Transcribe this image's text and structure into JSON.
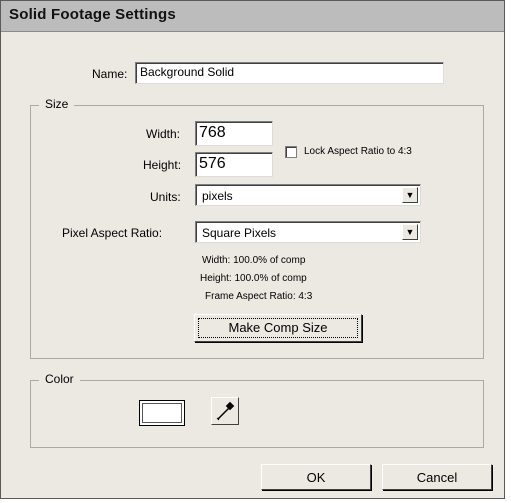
{
  "window": {
    "title": "Solid Footage Settings"
  },
  "name_field": {
    "label": "Name:",
    "value": "Background Solid"
  },
  "size_group": {
    "legend": "Size",
    "width_label": "Width:",
    "width_value": "768",
    "height_label": "Height:",
    "height_value": "576",
    "lock_label": "Lock Aspect Ratio to 4:3",
    "lock_checked": false,
    "units_label": "Units:",
    "units_value": "pixels",
    "par_label": "Pixel Aspect Ratio:",
    "par_value": "Square Pixels",
    "info_width": "Width:  100.0% of comp",
    "info_height": "Height:  100.0% of comp",
    "info_frame": "Frame Aspect Ratio: 4:3",
    "make_comp_size_label": "Make Comp Size"
  },
  "color_group": {
    "legend": "Color",
    "swatch_color": "#ffffff"
  },
  "buttons": {
    "ok": "OK",
    "cancel": "Cancel"
  },
  "icons": {
    "eyedropper": "eyedropper-icon",
    "dropdown_arrow": "dropdown-arrow-icon"
  }
}
